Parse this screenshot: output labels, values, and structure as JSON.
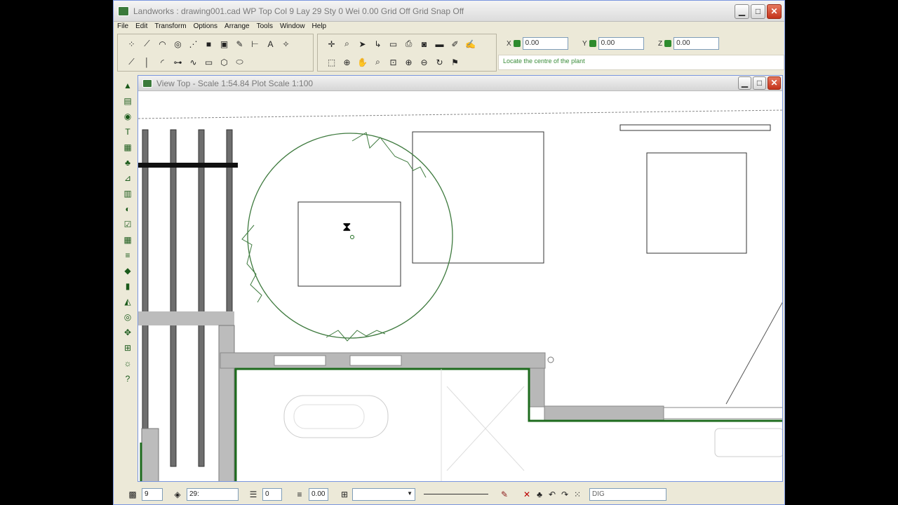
{
  "app": {
    "title": "Landworks : drawing001.cad    WP Top   Col 9 Lay 29  Sty 0 Wei 0.00    Grid Off    Grid Snap Off",
    "buttons": {
      "minimize": "▁",
      "maximize": "□",
      "close": "✕"
    }
  },
  "menu": [
    "File",
    "Edit",
    "Transform",
    "Options",
    "Arrange",
    "Tools",
    "Window",
    "Help"
  ],
  "coords": {
    "x_label": "X",
    "x_value": "0.00",
    "y_label": "Y",
    "y_value": "0.00",
    "z_label": "Z",
    "z_value": "0.00"
  },
  "prompt": "Locate the centre of the plant",
  "view": {
    "title": "View Top - Scale 1:54.84 Plot Scale 1:100"
  },
  "status": {
    "colour_value": "9",
    "layer_value": "29:",
    "style_value": "0",
    "weight_value": "0.00",
    "mode": "DIG"
  },
  "colors": {
    "accent_green": "#1d6b1d",
    "plant_circle": "#3e7a3e"
  }
}
